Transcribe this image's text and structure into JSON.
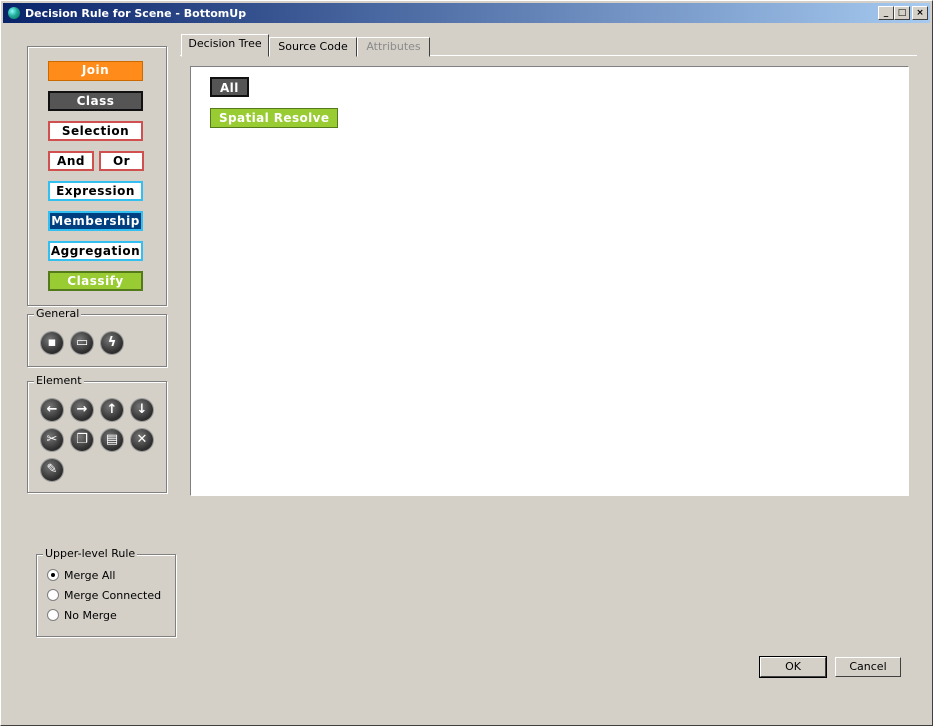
{
  "window": {
    "title": "Decision Rule for Scene - BottomUp",
    "controls": {
      "minimize": "_",
      "maximize": "□",
      "close": "×"
    }
  },
  "palette": {
    "join": "Join",
    "class": "Class",
    "selection": "Selection",
    "and": "And",
    "or": "Or",
    "expression": "Expression",
    "membership": "Membership",
    "aggregation": "Aggregation",
    "classify": "Classify"
  },
  "colors": {
    "join": "#ff8c1a",
    "class": "#555555",
    "selection_border": "#d05050",
    "expression_border": "#33c0f0",
    "membership": "#003f7f",
    "classify": "#99cc33"
  },
  "general": {
    "label": "General",
    "icons": [
      "new-icon",
      "image-icon",
      "lightning-icon"
    ]
  },
  "element": {
    "label": "Element",
    "icons": [
      "arrow-left-icon",
      "arrow-right-icon",
      "arrow-up-icon",
      "arrow-down-icon",
      "cut-icon",
      "copy-icon",
      "paste-icon",
      "delete-icon",
      "edit-icon"
    ]
  },
  "tabs": [
    {
      "label": "Decision Tree",
      "state": "active"
    },
    {
      "label": "Source Code",
      "state": "normal"
    },
    {
      "label": "Attributes",
      "state": "disabled"
    }
  ],
  "tree": {
    "nodes": [
      {
        "label": "All",
        "type": "class"
      },
      {
        "label": "Spatial Resolve",
        "type": "classify"
      }
    ]
  },
  "upper_rule": {
    "label": "Upper-level Rule",
    "options": [
      "Merge All",
      "Merge Connected",
      "No Merge"
    ],
    "selected": "Merge All"
  },
  "buttons": {
    "ok": "OK",
    "cancel": "Cancel"
  }
}
